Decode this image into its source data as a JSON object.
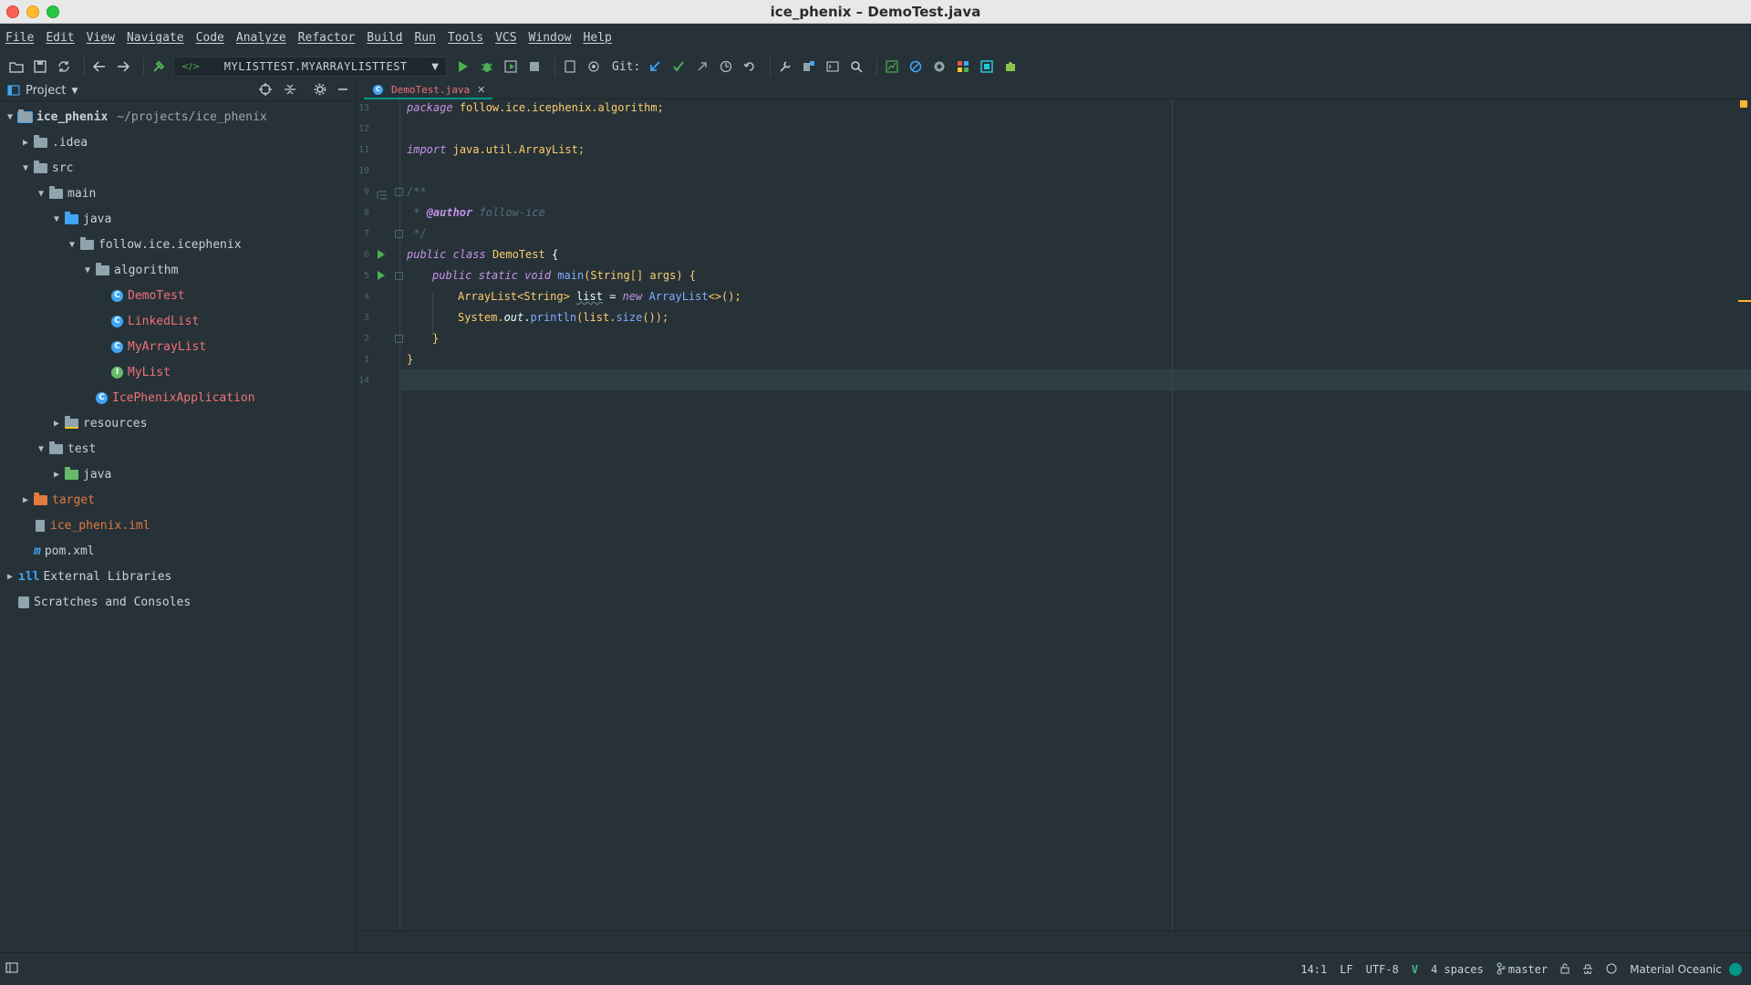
{
  "window": {
    "title": "ice_phenix – DemoTest.java"
  },
  "menu": [
    "File",
    "Edit",
    "View",
    "Navigate",
    "Code",
    "Analyze",
    "Refactor",
    "Build",
    "Run",
    "Tools",
    "VCS",
    "Window",
    "Help"
  ],
  "toolbar": {
    "run_config": "MYLISTTEST.MYARRAYLISTTEST",
    "git_label": "Git:"
  },
  "project": {
    "title": "Project",
    "tree": [
      {
        "label": "ice_phenix",
        "extra": "~/projects/ice_phenix",
        "depth": 0,
        "arrow": "open",
        "icon": "module-folder"
      },
      {
        "label": ".idea",
        "depth": 1,
        "arrow": "closed",
        "icon": "folder"
      },
      {
        "label": "src",
        "depth": 1,
        "arrow": "open",
        "icon": "folder"
      },
      {
        "label": "main",
        "depth": 2,
        "arrow": "open",
        "icon": "folder"
      },
      {
        "label": "java",
        "depth": 3,
        "arrow": "open",
        "icon": "source-folder"
      },
      {
        "label": "follow.ice.icephenix",
        "depth": 4,
        "arrow": "open",
        "icon": "package"
      },
      {
        "label": "algorithm",
        "depth": 5,
        "arrow": "open",
        "icon": "package"
      },
      {
        "label": "DemoTest",
        "depth": 6,
        "arrow": "none",
        "icon": "class"
      },
      {
        "label": "LinkedList",
        "depth": 6,
        "arrow": "none",
        "icon": "class"
      },
      {
        "label": "MyArrayList",
        "depth": 6,
        "arrow": "none",
        "icon": "class"
      },
      {
        "label": "MyList",
        "depth": 6,
        "arrow": "none",
        "icon": "interface"
      },
      {
        "label": "IcePhenixApplication",
        "depth": 5,
        "arrow": "none",
        "icon": "class"
      },
      {
        "label": "resources",
        "depth": 3,
        "arrow": "closed",
        "icon": "resources-folder"
      },
      {
        "label": "test",
        "depth": 2,
        "arrow": "open",
        "icon": "folder"
      },
      {
        "label": "java",
        "depth": 3,
        "arrow": "closed",
        "icon": "test-folder"
      },
      {
        "label": "target",
        "depth": 1,
        "arrow": "closed",
        "icon": "excluded-folder"
      },
      {
        "label": "ice_phenix.iml",
        "depth": 1,
        "arrow": "none",
        "icon": "iml-file"
      },
      {
        "label": "pom.xml",
        "depth": 1,
        "arrow": "none",
        "icon": "maven-file"
      },
      {
        "label": "External Libraries",
        "depth": 0,
        "arrow": "closed",
        "icon": "libraries"
      },
      {
        "label": "Scratches and Consoles",
        "depth": 0,
        "arrow": "none",
        "icon": "scratches"
      }
    ]
  },
  "editor": {
    "tab": "DemoTest.java",
    "line_numbers": [
      "13",
      "12",
      "11",
      "10",
      "9",
      "8",
      "7",
      "6",
      "5",
      "4",
      "3",
      "2",
      "1",
      "14"
    ],
    "code": {
      "l1_kw": "package",
      "l1_rest": "follow.ice.icephenix.algorithm;",
      "l3_kw": "import",
      "l3_rest": "java.util.ArrayList;",
      "l5": "/**",
      "l6_star": " * ",
      "l6_tag": "@author",
      "l6_rest": " follow-ice",
      "l7": " */",
      "l8_kw": "public class",
      "l8_cls": "DemoTest",
      "l8_rest": " {",
      "l9_kw": "public static void",
      "l9_fn": "main",
      "l9_rest": "(String[] args) {",
      "l10_type": "ArrayList<String>",
      "l10_var": "list",
      "l10_eq": " = ",
      "l10_new": "new",
      "l10_cls": "ArrayList",
      "l10_rest": "<>();",
      "l11_a": "System.",
      "l11_out": "out",
      "l11_dot": ".",
      "l11_fn": "println",
      "l11_b": "(list.",
      "l11_size": "size",
      "l11_c": "());",
      "l12": "}",
      "l13": "}"
    }
  },
  "status": {
    "position": "14:1",
    "line_sep": "LF",
    "encoding": "UTF-8",
    "indent": "4 spaces",
    "branch": "master",
    "theme": "Material Oceanic"
  },
  "colors": {
    "accent": "#009688",
    "background": "#263238",
    "keyword": "#c792ea",
    "type": "#ffcb6b",
    "function": "#82aaff"
  }
}
